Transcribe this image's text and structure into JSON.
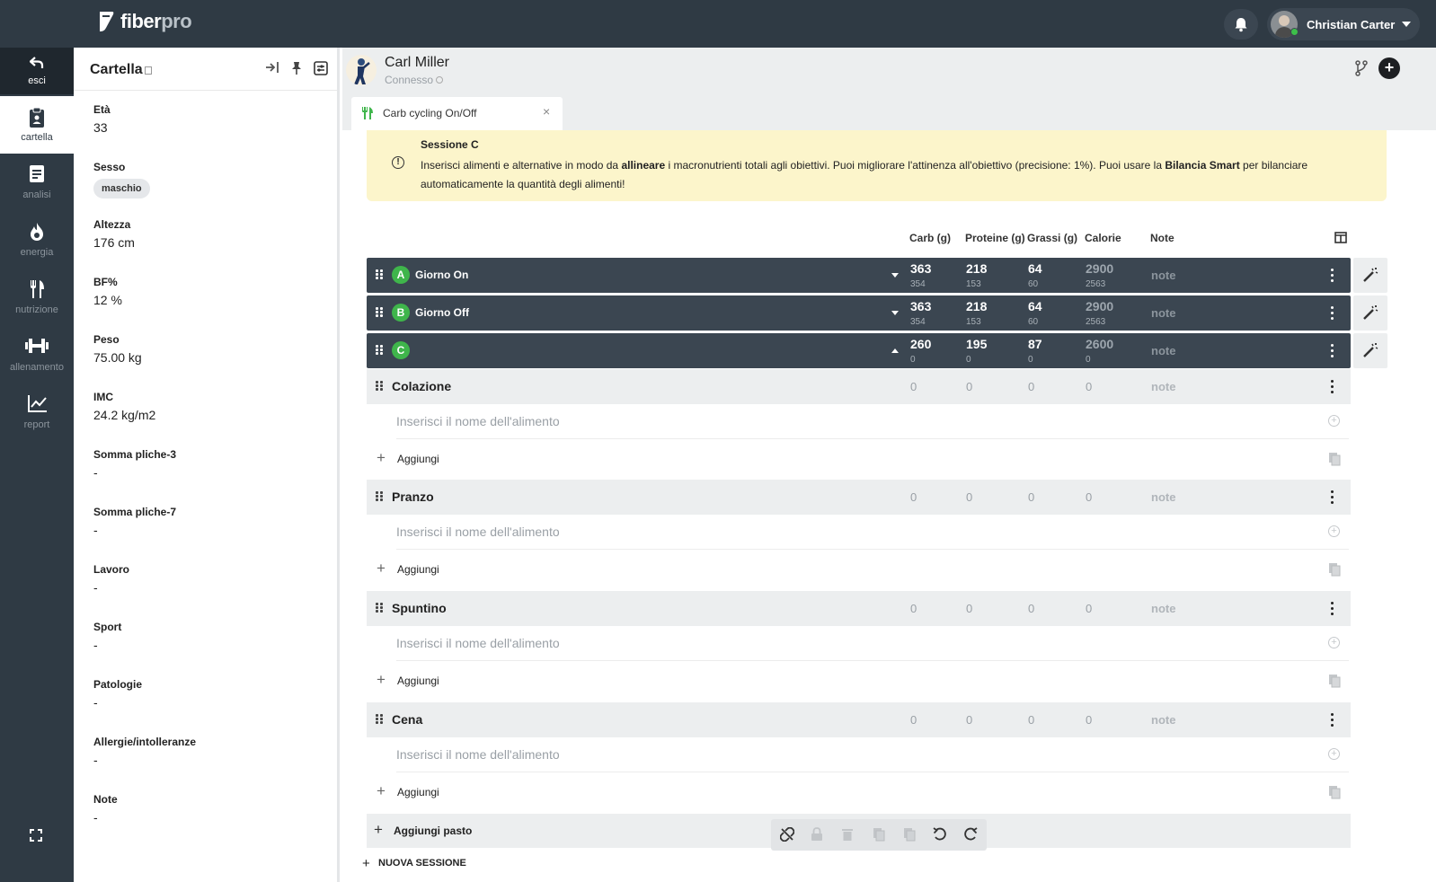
{
  "app": {
    "brand_name": "fiber",
    "brand_name_suffix": "pro",
    "user_name": "Christian Carter"
  },
  "nav": {
    "exit": "esci",
    "items": [
      "cartella",
      "analisi",
      "energia",
      "nutrizione",
      "allenamento",
      "report"
    ]
  },
  "cartella": {
    "title": "Cartella",
    "fields": [
      {
        "label": "Età",
        "value": "33"
      },
      {
        "label": "Sesso",
        "value": "maschio"
      },
      {
        "label": "Altezza",
        "value": "176 cm"
      },
      {
        "label": "BF%",
        "value": "12 %"
      },
      {
        "label": "Peso",
        "value": "75.00 kg"
      },
      {
        "label": "IMC",
        "value": "24.2 kg/m2"
      },
      {
        "label": "Somma pliche-3",
        "value": "-"
      },
      {
        "label": "Somma pliche-7",
        "value": "-"
      },
      {
        "label": "Lavoro",
        "value": "-"
      },
      {
        "label": "Sport",
        "value": "-"
      },
      {
        "label": "Patologie",
        "value": "-"
      },
      {
        "label": "Allergie/intolleranze",
        "value": "-"
      },
      {
        "label": "Note",
        "value": "-"
      }
    ]
  },
  "client": {
    "name": "Carl Miller",
    "status": "Connesso"
  },
  "tab": {
    "label": "Carb cycling On/Off",
    "close": "×"
  },
  "alert": {
    "icon": "!",
    "title": "Sessione C",
    "text_1": "Inserisci alimenti e alternative in modo da ",
    "text_bold_1": "allineare",
    "text_2": " i macronutrienti totali agli obiettivi. Puoi migliorare l'attinenza all'obiettivo (precisione: 1%). Puoi usare la ",
    "text_bold_2": "Bilancia Smart",
    "text_3": " per bilanciare automaticamente la quantità degli alimenti!"
  },
  "columns": {
    "carb": "Carb (g)",
    "protein": "Proteine (g)",
    "fat": "Grassi (g)",
    "calories": "Calorie",
    "note": "Note"
  },
  "sessions": [
    {
      "letter": "A",
      "name": "Giorno On",
      "carb": "363",
      "carb_t": "354",
      "protein": "218",
      "protein_t": "153",
      "fat": "64",
      "fat_t": "60",
      "cal": "2900",
      "cal_t": "2563",
      "note": "note",
      "expanded": false
    },
    {
      "letter": "B",
      "name": "Giorno Off",
      "carb": "363",
      "carb_t": "354",
      "protein": "218",
      "protein_t": "153",
      "fat": "64",
      "fat_t": "60",
      "cal": "2900",
      "cal_t": "2563",
      "note": "note",
      "expanded": false
    },
    {
      "letter": "C",
      "name": "",
      "carb": "260",
      "carb_t": "0",
      "protein": "195",
      "protein_t": "0",
      "fat": "87",
      "fat_t": "0",
      "cal": "2600",
      "cal_t": "0",
      "note": "note",
      "expanded": true
    }
  ],
  "meals": [
    {
      "name": "Colazione",
      "carb": "0",
      "protein": "0",
      "fat": "0",
      "cal": "0",
      "note": "note"
    },
    {
      "name": "Pranzo",
      "carb": "0",
      "protein": "0",
      "fat": "0",
      "cal": "0",
      "note": "note"
    },
    {
      "name": "Spuntino",
      "carb": "0",
      "protein": "0",
      "fat": "0",
      "cal": "0",
      "note": "note"
    },
    {
      "name": "Cena",
      "carb": "0",
      "protein": "0",
      "fat": "0",
      "cal": "0",
      "note": "note"
    }
  ],
  "food_placeholder": "Inserisci il nome dell'alimento",
  "add_label": "Aggiungi",
  "add_meal_label": "Aggiungi pasto",
  "new_session_label": "NUOVA SESSIONE",
  "colors": {
    "dark": "#2f3a44",
    "session_bar": "#3b4651",
    "badge_green": "#3fb54b",
    "alert_bg": "#fcf5cb",
    "meal_bg": "#eceeef"
  }
}
